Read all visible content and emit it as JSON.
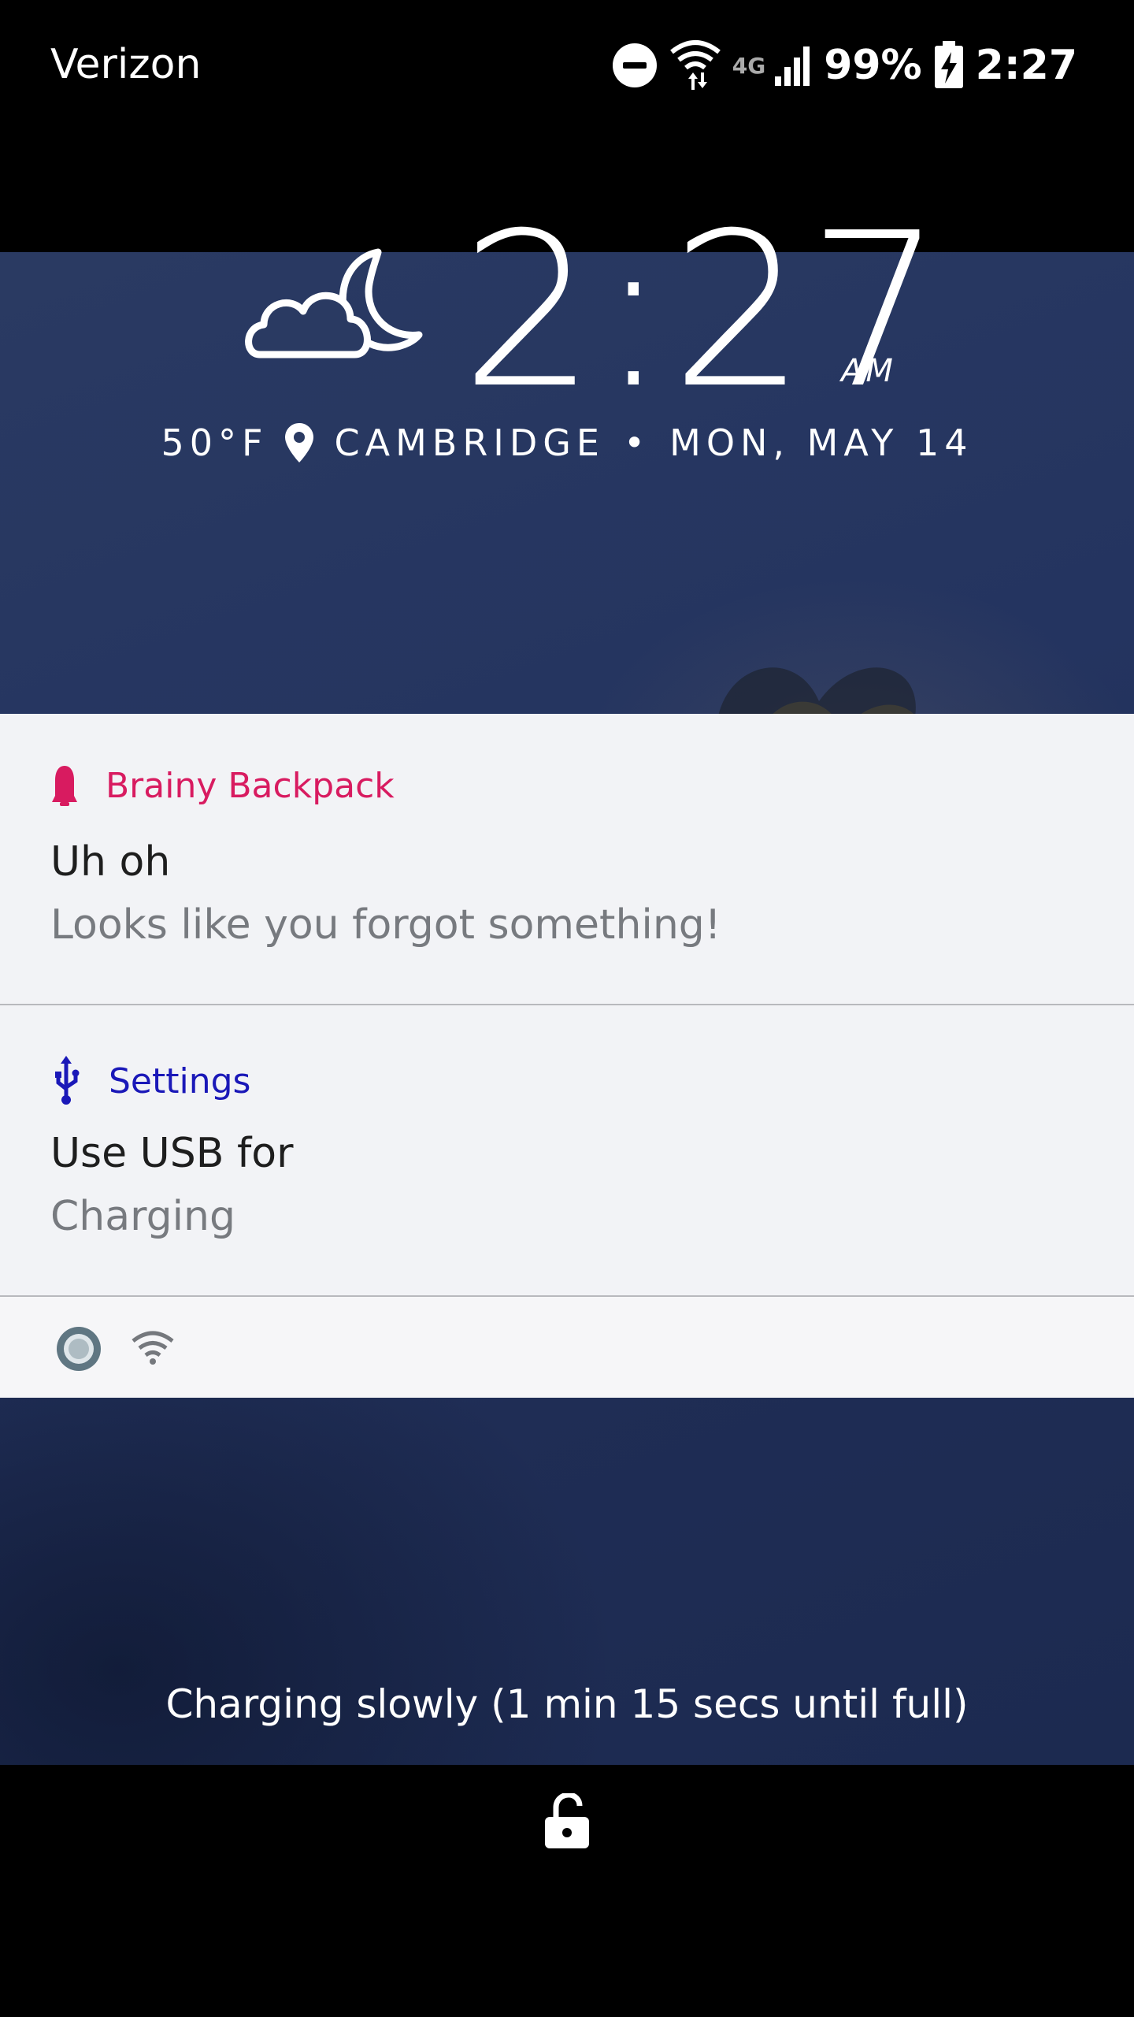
{
  "status_bar": {
    "carrier": "Verizon",
    "network": "4G",
    "battery_percent": "99%",
    "time": "2:27",
    "icons": [
      "do-not-disturb-icon",
      "wifi-icon",
      "cell-signal-icon",
      "battery-charging-icon"
    ]
  },
  "clock": {
    "time": "2:27",
    "ampm": "AM",
    "weather_icon": "cloudy-night-icon",
    "temperature": "50°F",
    "location": "CAMBRIDGE",
    "separator": "•",
    "date": "MON, MAY 14"
  },
  "notifications": [
    {
      "app": "Brainy Backpack",
      "app_color": "#d81b60",
      "icon": "bell-icon",
      "title": "Uh oh",
      "text": "Looks like you forgot something!"
    },
    {
      "app": "Settings",
      "app_color": "#1a18b8",
      "icon": "usb-icon",
      "title": "Use USB for",
      "text": "Charging"
    }
  ],
  "footer_icons": [
    "circle-record-icon",
    "wifi-icon"
  ],
  "charging_status": "Charging slowly (1 min 15 secs until full)",
  "lock_icon": "unlock-icon"
}
